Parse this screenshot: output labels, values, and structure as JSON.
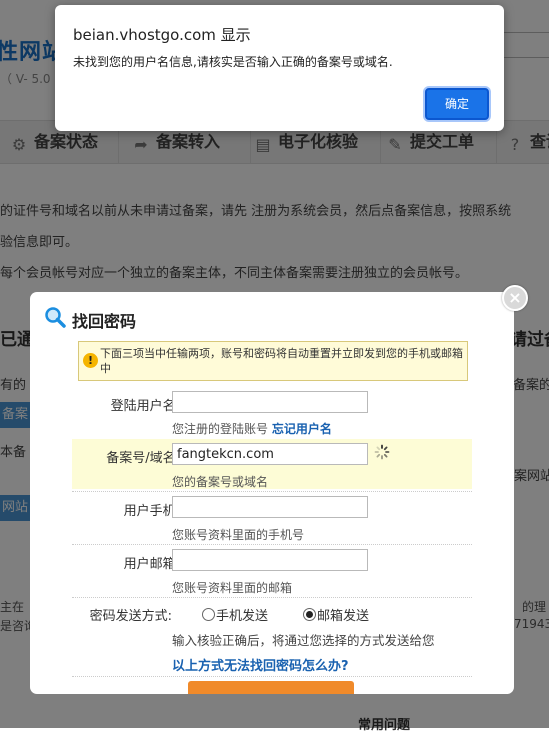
{
  "background": {
    "brand_text": "性网站",
    "version": "（ V- 5.0 ）",
    "nav": [
      {
        "icon": "status-icon",
        "glyph": "⚙",
        "label": "备案状态"
      },
      {
        "icon": "transfer-icon",
        "glyph": "➦",
        "label": "备案转入"
      },
      {
        "icon": "document-icon",
        "glyph": "▤",
        "label": "电子化核验"
      },
      {
        "icon": "ticket-icon",
        "glyph": "✎",
        "label": "提交工单"
      },
      {
        "icon": "help-icon",
        "glyph": "?",
        "label": "查询"
      }
    ],
    "para1": "的证件号和域名以前从未申请过备案，请先 注册为系统会员，然后点备案信息，按照系统",
    "para2": "验信息即可。",
    "para3": "每个会员帐号对应一个独立的备案主体，不同主体备案需要注册独立的会员帐号。",
    "panel_left": "已通",
    "panel_right": "请过备",
    "left_text1": "有的",
    "left_btn1": "备案",
    "left_text2": "本备",
    "left_btn2": "网站",
    "right_text1": "备案的",
    "right_text2": "案网站",
    "bottom_left1": "主在",
    "bottom_left2": "是咨询",
    "bottom_right1": "的理",
    "bottom_right2": "71943",
    "footer_heading": "常用问题"
  },
  "modal": {
    "title": "找回密码",
    "tip": "下面三项当中任输两项，账号和密码将自动重置并立即发到您的手机或邮箱中",
    "username_label": "登陆用户名:",
    "username_value": "",
    "username_hint": "您注册的登陆账号",
    "forgot_username_link": "忘记用户名",
    "domain_label": "备案号/域名:",
    "domain_value": "fangtekcn.com",
    "domain_hint": "您的备案号或域名",
    "phone_label": "用户手机:",
    "phone_value": "",
    "phone_hint": "您账号资料里面的手机号",
    "email_label": "用户邮箱:",
    "email_value": "",
    "email_hint": "您账号资料里面的邮箱",
    "send_method_label": "密码发送方式:",
    "send_options": [
      "手机发送",
      "邮箱发送"
    ],
    "send_selected": "邮箱发送",
    "send_note": "输入核验正确后，将通过您选择的方式发送给您",
    "help_link": "以上方式无法找回密码怎么办?"
  },
  "alert": {
    "title": "beian.vhostgo.com 显示",
    "message": "未找到您的用户名信息,请核实是否输入正确的备案号或域名.",
    "ok_label": "确定",
    "accent": "#1a73e8"
  }
}
